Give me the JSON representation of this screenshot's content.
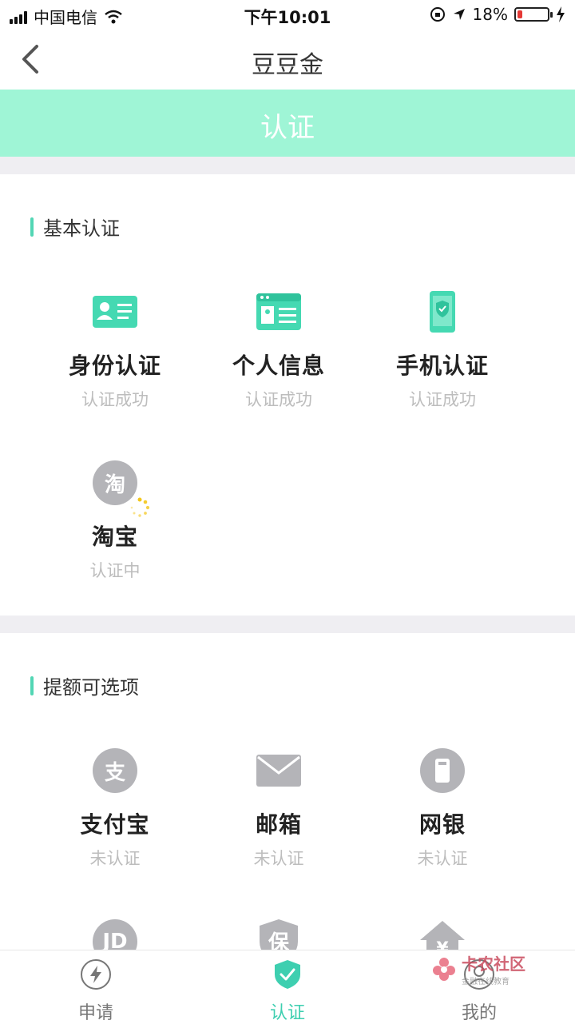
{
  "status_bar": {
    "carrier": "中国电信",
    "time": "下午10:01",
    "battery": "18%",
    "battery_level": 0.18
  },
  "nav": {
    "title": "豆豆金"
  },
  "banner": {
    "label": "认证"
  },
  "basic": {
    "title": "基本认证",
    "items": [
      {
        "label": "身份认证",
        "status": "认证成功",
        "icon": "id-card-icon"
      },
      {
        "label": "个人信息",
        "status": "认证成功",
        "icon": "profile-card-icon"
      },
      {
        "label": "手机认证",
        "status": "认证成功",
        "icon": "phone-shield-icon"
      },
      {
        "label": "淘宝",
        "status": "认证中",
        "icon": "taobao-icon",
        "glyph": "淘"
      }
    ]
  },
  "optional": {
    "title": "提额可选项",
    "items": [
      {
        "label": "支付宝",
        "status": "未认证",
        "icon": "alipay-icon",
        "glyph": "支"
      },
      {
        "label": "邮箱",
        "status": "未认证",
        "icon": "mail-icon"
      },
      {
        "label": "网银",
        "status": "未认证",
        "icon": "bank-card-icon"
      },
      {
        "icon": "jd-icon",
        "glyph": "JD"
      },
      {
        "icon": "insurance-icon",
        "glyph": "保"
      },
      {
        "icon": "housing-fund-icon",
        "glyph": "¥"
      }
    ]
  },
  "tabs": [
    {
      "label": "申请",
      "icon": "lightning-icon",
      "active": false
    },
    {
      "label": "认证",
      "icon": "shield-check-icon",
      "active": true
    },
    {
      "label": "我的",
      "icon": "user-icon",
      "active": false
    }
  ],
  "watermark": {
    "text": "卡农社区",
    "sub": "金融在线教育"
  },
  "colors": {
    "accent": "#3ecfb0",
    "banner": "#9ff5d6",
    "icon_grey": "#b4b4b8",
    "section_gap": "#efeef2"
  }
}
